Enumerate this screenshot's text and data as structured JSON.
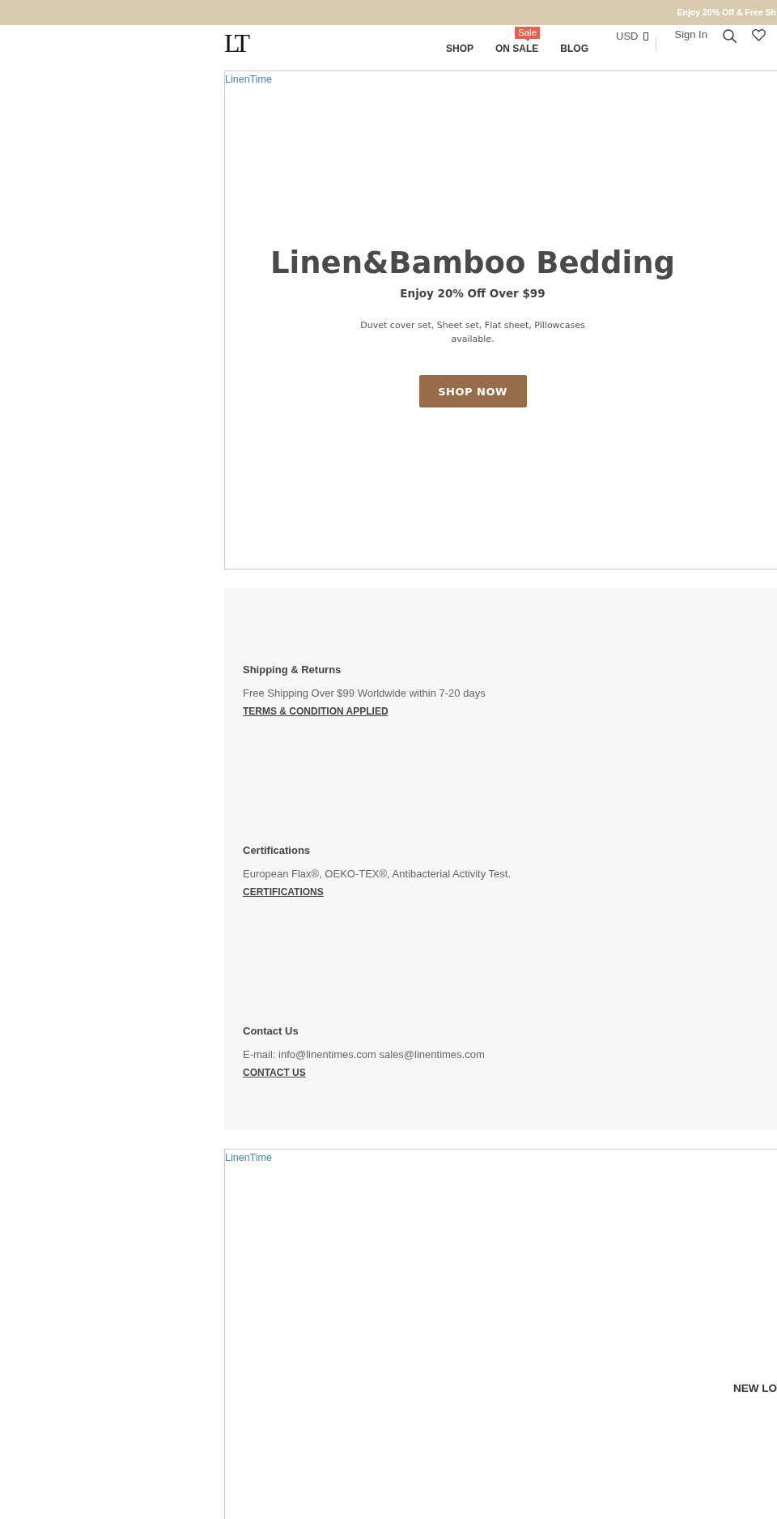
{
  "announcement": {
    "text": "Enjoy 20% Off & Free Sh"
  },
  "header": {
    "logo": "LT",
    "nav": [
      {
        "label": "SHOP"
      },
      {
        "label": "ON SALE",
        "badge": "Sale"
      },
      {
        "label": "BLOG"
      }
    ],
    "currency": "USD",
    "sign_in": "Sign In"
  },
  "hero": {
    "image_alt": "LinenTime",
    "title": "Linen&Bamboo Bedding",
    "subtitle": "Enjoy 20% Off Over $99",
    "description": "Duvet cover set, Sheet set, Flat sheet, Pillowcases available.",
    "button": "SHOP NOW"
  },
  "features": [
    {
      "title": "Shipping & Returns",
      "text": "Free Shipping Over $99 Worldwide within 7-20 days",
      "link": "TERMS & CONDITION APPLIED"
    },
    {
      "title": "Certifications",
      "text": "European Flax®, OEKO-TEX®, Antibacterial Activity Test.",
      "link": "CERTIFICATIONS"
    },
    {
      "title": "Contact Us",
      "text": "E-mail: info@linentimes.com sales@linentimes.com",
      "link": "CONTACT US"
    }
  ],
  "banner": {
    "image_alt": "LinenTime",
    "heading": "NEW LO"
  }
}
